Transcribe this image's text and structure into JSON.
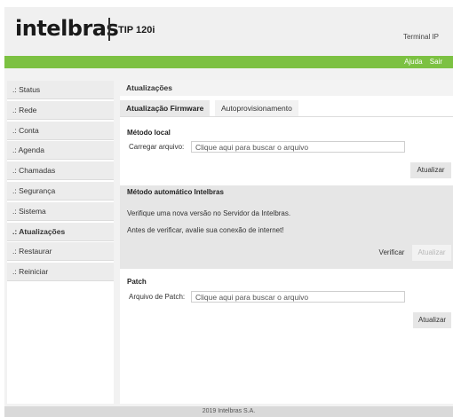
{
  "header": {
    "logo": "intelbras",
    "model": "TIP 120i",
    "device_label": "Terminal IP"
  },
  "topnav": {
    "help": "Ajuda",
    "logout": "Sair"
  },
  "sidebar": {
    "items": [
      {
        "label": ".: Status"
      },
      {
        "label": ".: Rede"
      },
      {
        "label": ".: Conta"
      },
      {
        "label": ".: Agenda"
      },
      {
        "label": ".: Chamadas"
      },
      {
        "label": ".: Segurança"
      },
      {
        "label": ".: Sistema"
      },
      {
        "label": ".: Atualizações"
      },
      {
        "label": ".: Restaurar"
      },
      {
        "label": ".: Reiniciar"
      }
    ]
  },
  "main": {
    "title": "Atualizações",
    "tabs": [
      {
        "label": "Atualização Firmware"
      },
      {
        "label": "Autoprovisionamento"
      }
    ],
    "local": {
      "heading": "Método local",
      "file_label": "Carregar arquivo:",
      "file_placeholder": "Clique aqui para buscar o arquivo",
      "update_button": "Atualizar"
    },
    "auto": {
      "heading": "Método automático Intelbras",
      "line1": "Verifique uma nova versão no Servidor da Intelbras.",
      "line2": "Antes de verificar, avalie sua conexão de internet!",
      "verify_button": "Verificar",
      "update_button": "Atualizar"
    },
    "patch": {
      "heading": "Patch",
      "file_label": "Arquivo de Patch:",
      "file_placeholder": "Clique aqui para buscar o arquivo",
      "update_button": "Atualizar"
    }
  },
  "footer": {
    "copyright": "2019 Intelbras S.A."
  },
  "colors": {
    "accent_green": "#7cc142"
  }
}
